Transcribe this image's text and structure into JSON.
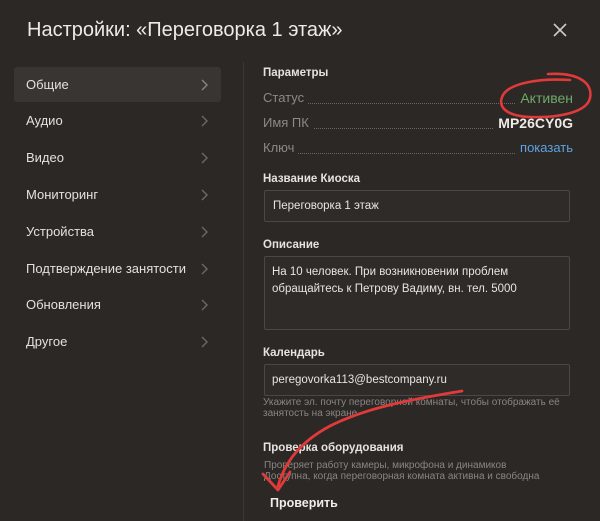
{
  "header": {
    "title": "Настройки: «Переговорка 1 этаж»",
    "close_icon": "close-icon"
  },
  "sidebar": {
    "items": [
      {
        "label": "Общие",
        "active": true
      },
      {
        "label": "Аудио"
      },
      {
        "label": "Видео"
      },
      {
        "label": "Мониторинг"
      },
      {
        "label": "Устройства"
      },
      {
        "label": "Подтверждение занятости"
      },
      {
        "label": "Обновления"
      },
      {
        "label": "Другое"
      }
    ]
  },
  "params": {
    "title": "Параметры",
    "status_label": "Статус",
    "status_value": "Активен",
    "pc_label": "Имя ПК",
    "pc_value": "MP26CY0G",
    "key_label": "Ключ",
    "key_link": "показать"
  },
  "kiosk": {
    "title": "Название Киоска",
    "value": "Переговорка 1 этаж"
  },
  "description": {
    "title": "Описание",
    "line1": "На 10 человек. При возникновении проблем",
    "line2": "обращайтесь к Петрову Вадиму, вн. тел. 5000"
  },
  "calendar": {
    "title": "Календарь",
    "value": "peregovorka113@bestcompany.ru",
    "help1": "Укажите эл. почту переговорной комнаты, чтобы отображать её",
    "help2": "занятость на экране"
  },
  "equipment": {
    "title": "Проверка оборудования",
    "line1": "Проверяет работу камеры, микрофона и динамиков",
    "line2": "Доступна, когда переговорная комната активна и свободна",
    "button": "Проверить"
  },
  "colors": {
    "status_active": "#6fa86a",
    "link": "#5fa3e0",
    "annotation": "#e03a3a",
    "background": "#2b2826"
  }
}
